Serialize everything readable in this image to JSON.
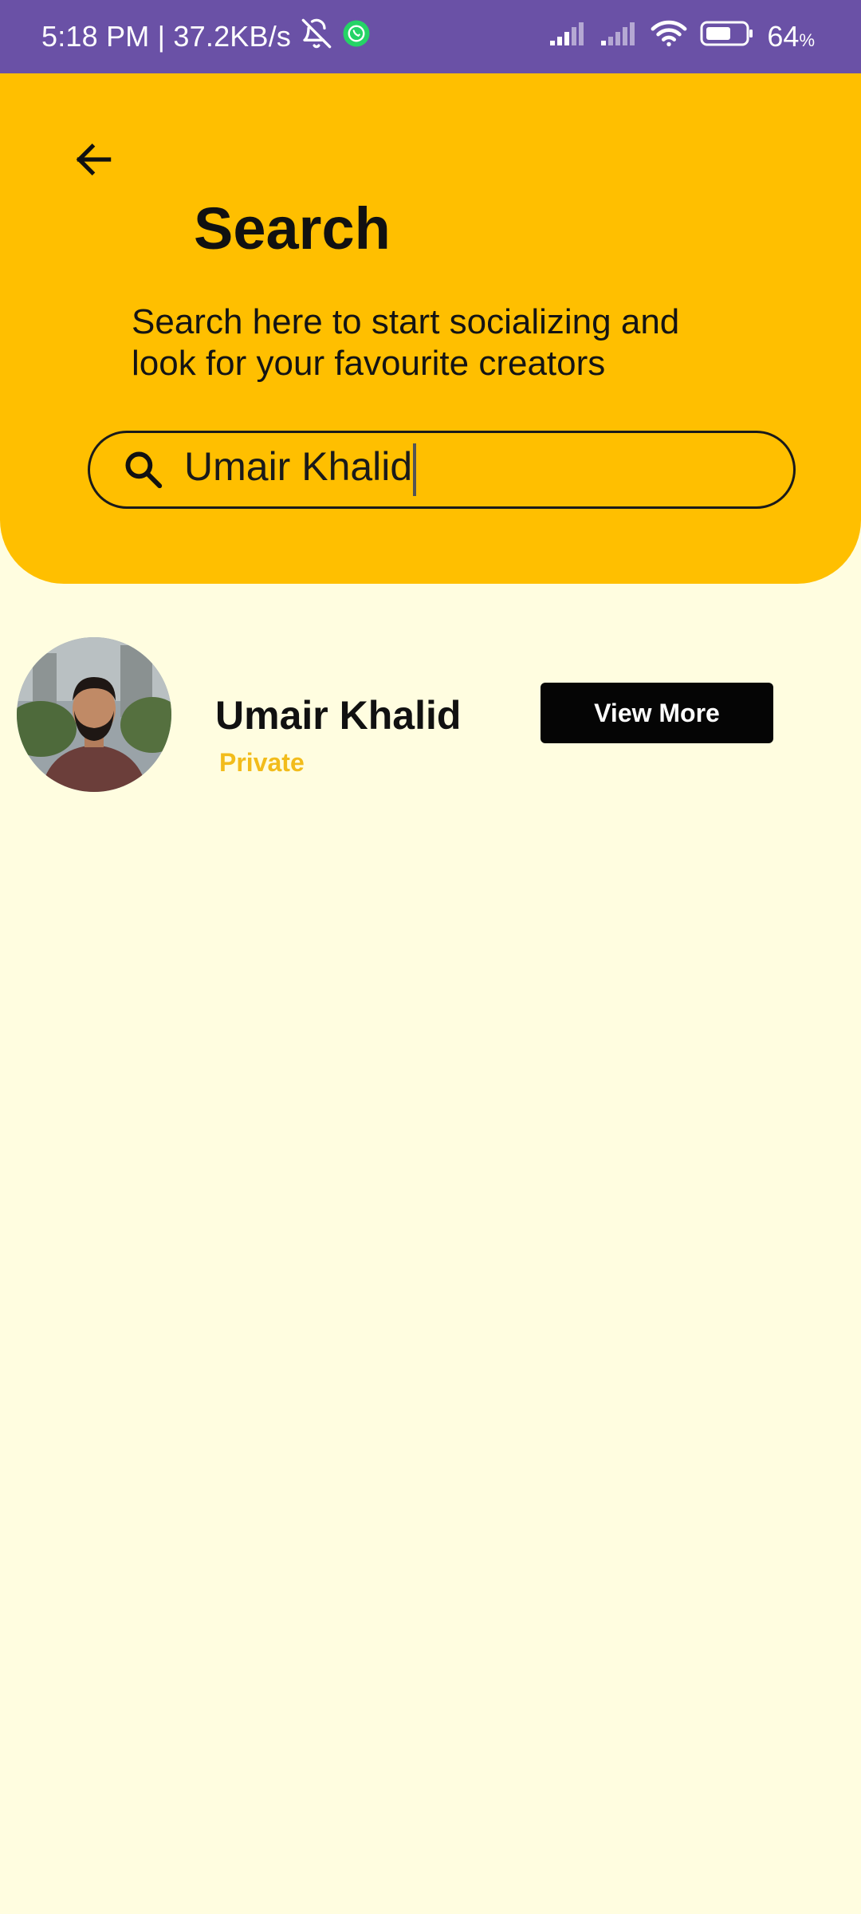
{
  "status_bar": {
    "time_speed": "5:18 PM | 37.2KB/s",
    "battery_level": "64",
    "battery_unit": "%",
    "icons": [
      "bell-off-icon",
      "whatsapp-icon",
      "signal-icon",
      "signal-icon",
      "wifi-icon",
      "battery-icon"
    ]
  },
  "header": {
    "title": "Search",
    "subtitle": "Search here to start socializing and look for your favourite creators",
    "back_icon": "arrow-left-icon"
  },
  "search": {
    "value": "Umair Khalid",
    "icon": "search-icon"
  },
  "results": [
    {
      "name": "Umair Khalid",
      "privacy": "Private",
      "button_label": "View More"
    }
  ],
  "colors": {
    "status_bar": "#6A51A6",
    "header": "#FFBF00",
    "background": "#FFFDE0",
    "accent_text": "#F2BC1B",
    "button": "#050505"
  }
}
